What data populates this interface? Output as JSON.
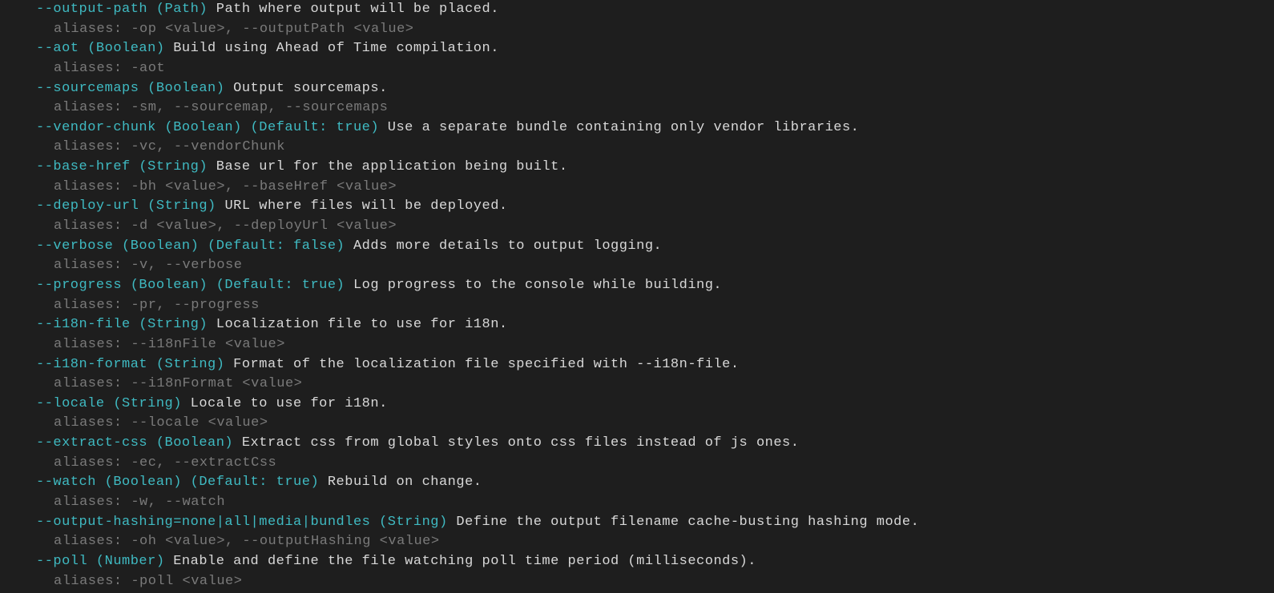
{
  "options": [
    {
      "flag": "--output-path (Path)",
      "desc": " Path where output will be placed.",
      "alias": "aliases: -op <value>, --outputPath <value>"
    },
    {
      "flag": "--aot (Boolean)",
      "desc": " Build using Ahead of Time compilation.",
      "alias": "aliases: -aot"
    },
    {
      "flag": "--sourcemaps (Boolean)",
      "desc": " Output sourcemaps.",
      "alias": "aliases: -sm, --sourcemap, --sourcemaps"
    },
    {
      "flag": "--vendor-chunk (Boolean) (Default: true)",
      "desc": " Use a separate bundle containing only vendor libraries.",
      "alias": "aliases: -vc, --vendorChunk"
    },
    {
      "flag": "--base-href (String)",
      "desc": " Base url for the application being built.",
      "alias": "aliases: -bh <value>, --baseHref <value>"
    },
    {
      "flag": "--deploy-url (String)",
      "desc": " URL where files will be deployed.",
      "alias": "aliases: -d <value>, --deployUrl <value>"
    },
    {
      "flag": "--verbose (Boolean) (Default: false)",
      "desc": " Adds more details to output logging.",
      "alias": "aliases: -v, --verbose"
    },
    {
      "flag": "--progress (Boolean) (Default: true)",
      "desc": " Log progress to the console while building.",
      "alias": "aliases: -pr, --progress"
    },
    {
      "flag": "--i18n-file (String)",
      "desc": " Localization file to use for i18n.",
      "alias": "aliases: --i18nFile <value>"
    },
    {
      "flag": "--i18n-format (String)",
      "desc": " Format of the localization file specified with --i18n-file.",
      "alias": "aliases: --i18nFormat <value>"
    },
    {
      "flag": "--locale (String)",
      "desc": " Locale to use for i18n.",
      "alias": "aliases: --locale <value>"
    },
    {
      "flag": "--extract-css (Boolean)",
      "desc": " Extract css from global styles onto css files instead of js ones.",
      "alias": "aliases: -ec, --extractCss"
    },
    {
      "flag": "--watch (Boolean) (Default: true)",
      "desc": " Rebuild on change.",
      "alias": "aliases: -w, --watch"
    },
    {
      "flag": "--output-hashing=none|all|media|bundles (String)",
      "desc": " Define the output filename cache-busting hashing mode.",
      "alias": "aliases: -oh <value>, --outputHashing <value>"
    },
    {
      "flag": "--poll (Number)",
      "desc": " Enable and define the file watching poll time period (milliseconds).",
      "alias": "aliases: -poll <value>"
    }
  ]
}
